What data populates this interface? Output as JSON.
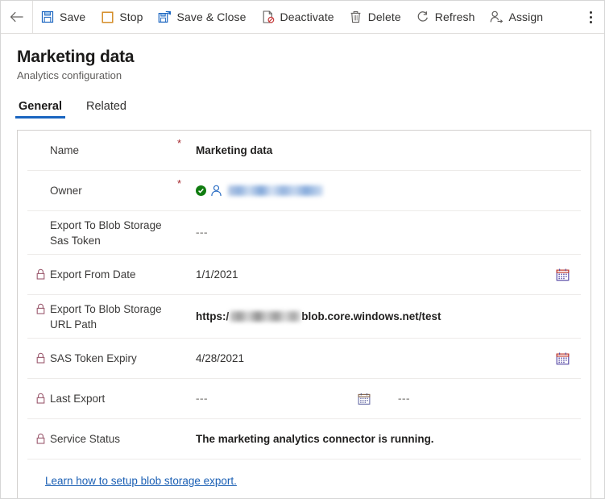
{
  "commandbar": {
    "back_label": "Back",
    "overflow_label": "More commands",
    "buttons": [
      {
        "label": "Save",
        "icon": "save-icon"
      },
      {
        "label": "Stop",
        "icon": "stop-icon"
      },
      {
        "label": "Save & Close",
        "icon": "save-and-close-icon"
      },
      {
        "label": "Deactivate",
        "icon": "deactivate-icon"
      },
      {
        "label": "Delete",
        "icon": "delete-icon"
      },
      {
        "label": "Refresh",
        "icon": "refresh-icon"
      },
      {
        "label": "Assign",
        "icon": "assign-icon"
      }
    ]
  },
  "header": {
    "title": "Marketing data",
    "subtitle": "Analytics configuration"
  },
  "tabs": [
    {
      "label": "General",
      "active": true
    },
    {
      "label": "Related",
      "active": false
    }
  ],
  "form": {
    "rows": [
      {
        "label": "Name",
        "required": "*",
        "locked": false,
        "value": "Marketing data"
      },
      {
        "label": "Owner",
        "required": "*",
        "locked": false,
        "value_redacted": true,
        "status_icon": "green-check-icon",
        "person_icon": "person-icon"
      },
      {
        "label": "Export To Blob Storage Sas Token",
        "required": "",
        "locked": false,
        "value": "---"
      },
      {
        "label": "Export From Date",
        "required": "",
        "locked": true,
        "value": "1/1/2021",
        "calendar": "calendar-icon"
      },
      {
        "label": "Export To Blob Storage URL Path",
        "required": "",
        "locked": true,
        "url_prefix": "https:/",
        "url_suffix": "blob.core.windows.net/test"
      },
      {
        "label": "SAS Token Expiry",
        "required": "",
        "locked": true,
        "value": "4/28/2021",
        "calendar": "calendar-icon"
      },
      {
        "label": "Last Export",
        "required": "",
        "locked": true,
        "value": "---",
        "value2": "---",
        "calendar": "calendar-icon"
      },
      {
        "label": "Service Status",
        "required": "",
        "locked": true,
        "value": "The marketing analytics connector is running."
      }
    ],
    "help_link": "Learn how to setup blob storage export."
  },
  "colors": {
    "accent": "#1a65c0",
    "link": "#1a5fb4",
    "required": "#a4262c",
    "success": "#107c10",
    "border": "#d2d0ce",
    "divider": "#edebe9"
  }
}
